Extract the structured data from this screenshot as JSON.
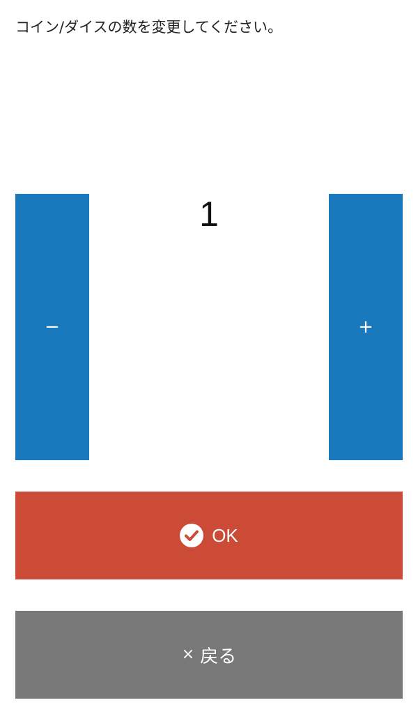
{
  "instruction": "コイン/ダイスの数を変更してください。",
  "stepper": {
    "value": "1",
    "decrement_label": "−",
    "increment_label": "+"
  },
  "ok_button": {
    "label": "OK",
    "icon": "check-circle-icon"
  },
  "back_button": {
    "label": "戻る",
    "icon": "close-icon",
    "icon_glyph": "×"
  },
  "colors": {
    "stepper_blue": "#1a78bc",
    "ok_red": "#cb4b36",
    "back_gray": "#787878"
  }
}
